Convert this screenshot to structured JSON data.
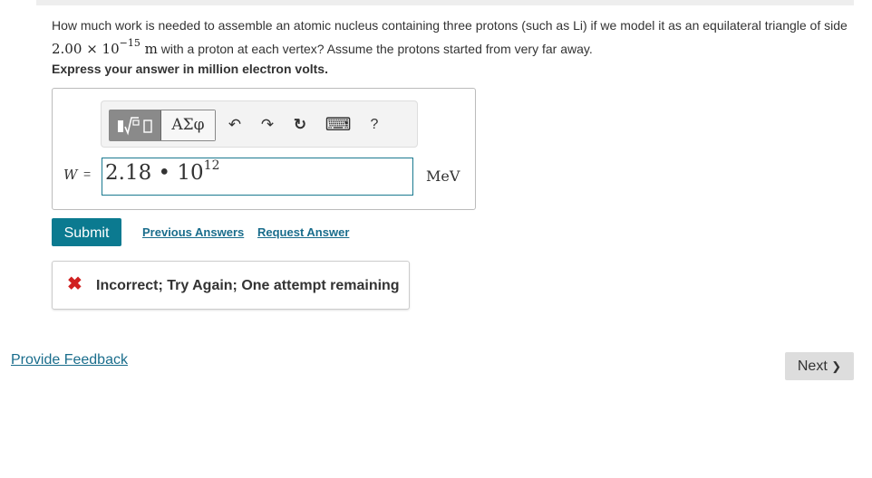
{
  "question": {
    "text_part1": "How much work is needed to assemble an atomic nucleus containing three protons (such as Li) if we model it as an equilateral triangle of side ",
    "side_value": "2.00",
    "times": "×",
    "base": "10",
    "exponent": "−15",
    "unit": "m",
    "text_part2": " with a proton at each vertex? Assume the protons started from very far away."
  },
  "instruction": "Express your answer in million electron volts.",
  "toolbar": {
    "greek_label": "ΑΣφ",
    "undo_glyph": "↶",
    "redo_glyph": "↷",
    "reset_glyph": "↻",
    "keyboard_glyph": "⌨",
    "help_label": "?"
  },
  "answer": {
    "variable": "W",
    "equals": "=",
    "mantissa": "2.18",
    "dot": "•",
    "base": "10",
    "exponent": "12",
    "unit": "MeV"
  },
  "actions": {
    "submit_label": "Submit",
    "previous_answers_label": "Previous Answers",
    "request_answer_label": "Request Answer"
  },
  "feedback": {
    "icon": "✖",
    "message": "Incorrect; Try Again; One attempt remaining"
  },
  "footer": {
    "provide_feedback_label": "Provide Feedback",
    "next_label": "Next",
    "next_chevron": "❯"
  },
  "colors": {
    "accent": "#0b7a90",
    "link": "#1a6d8c",
    "error": "#d02020"
  }
}
